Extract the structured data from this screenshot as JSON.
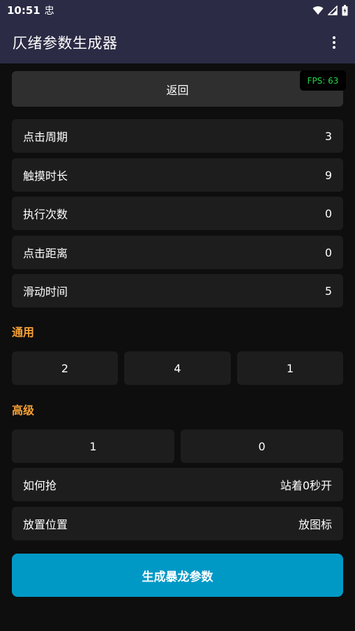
{
  "status_bar": {
    "time": "10:51",
    "app_icon_glyph": "忠",
    "icons": [
      "wifi-icon",
      "signal-icon",
      "battery-icon"
    ]
  },
  "app_bar": {
    "title": "仄绪参数生成器",
    "menu_icon": "more-vert-icon"
  },
  "back_button": {
    "label": "返回"
  },
  "fps": {
    "text": "FPS: 63",
    "color": "#25d84a"
  },
  "settings": [
    {
      "label": "点击周期",
      "value": "3"
    },
    {
      "label": "触摸时长",
      "value": "9"
    },
    {
      "label": "执行次数",
      "value": "0"
    },
    {
      "label": "点击距离",
      "value": "0"
    },
    {
      "label": "滑动时间",
      "value": "5"
    }
  ],
  "general": {
    "title": "通用",
    "options": [
      "2",
      "4",
      "1"
    ]
  },
  "advanced": {
    "title": "高级",
    "options": [
      "1",
      "0"
    ],
    "rows": [
      {
        "label": "如何抢",
        "value": "站着0秒开"
      },
      {
        "label": "放置位置",
        "value": "放图标"
      }
    ]
  },
  "generate_button": {
    "label": "生成暴龙参数"
  },
  "colors": {
    "app_bar": "#2b2b45",
    "background": "#0e0e0e",
    "row": "#1d1d1d",
    "section_title": "#f5a033",
    "primary_button": "#0099c6"
  }
}
